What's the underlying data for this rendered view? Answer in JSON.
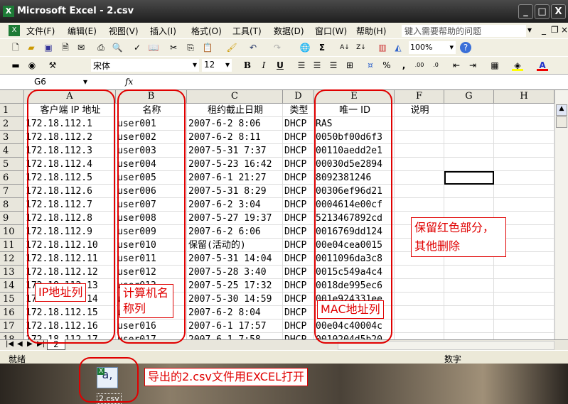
{
  "window": {
    "title": "Microsoft Excel - 2.csv",
    "min": "_",
    "max": "□",
    "close": "X"
  },
  "menu": [
    "文件(F)",
    "编辑(E)",
    "视图(V)",
    "插入(I)",
    "格式(O)",
    "工具(T)",
    "数据(D)",
    "窗口(W)",
    "帮助(H)"
  ],
  "help_placeholder": "键入需要帮助的问题",
  "toolbar": {
    "zoom": "100%",
    "font": "宋体",
    "size": "12",
    "bold": "B",
    "italic": "I",
    "underline": "U",
    "percent": "%",
    "comma": ",",
    "sigma": "Σ"
  },
  "formula": {
    "namebox": "G6",
    "fx": "fx",
    "value": ""
  },
  "columns": [
    "A",
    "B",
    "C",
    "D",
    "E",
    "F",
    "G",
    "H"
  ],
  "rows": [
    [
      "客户端 IP 地址",
      "名称",
      "租约截止日期",
      "类型",
      "唯一 ID",
      "说明"
    ],
    [
      "172.18.112.1",
      "user001",
      "2007-6-2 8:06",
      "DHCP",
      "RAS",
      ""
    ],
    [
      "172.18.112.2",
      "user002",
      "2007-6-2 8:11",
      "DHCP",
      "0050bf00d6f3",
      ""
    ],
    [
      "172.18.112.3",
      "user003",
      "2007-5-31 7:37",
      "DHCP",
      "00110aedd2e1",
      ""
    ],
    [
      "172.18.112.4",
      "user004",
      "2007-5-23 16:42",
      "DHCP",
      "00030d5e2894",
      ""
    ],
    [
      "172.18.112.5",
      "user005",
      "2007-6-1 21:27",
      "DHCP",
      "8092381246",
      ""
    ],
    [
      "172.18.112.6",
      "user006",
      "2007-5-31 8:29",
      "DHCP",
      "00306ef96d21",
      ""
    ],
    [
      "172.18.112.7",
      "user007",
      "2007-6-2 3:04",
      "DHCP",
      "0004614e00cf",
      ""
    ],
    [
      "172.18.112.8",
      "user008",
      "2007-5-27 19:37",
      "DHCP",
      "5213467892cd",
      ""
    ],
    [
      "172.18.112.9",
      "user009",
      "2007-6-2 6:06",
      "DHCP",
      "0016769dd124",
      ""
    ],
    [
      "172.18.112.10",
      "user010",
      "保留(活动的)",
      "DHCP",
      "00e04cea0015",
      ""
    ],
    [
      "172.18.112.11",
      "user011",
      "2007-5-31 14:04",
      "DHCP",
      "0011096da3c8",
      ""
    ],
    [
      "172.18.112.12",
      "user012",
      "2007-5-28 3:40",
      "DHCP",
      "0015c549a4c4",
      ""
    ],
    [
      "172.18.112.13",
      "user013",
      "2007-5-25 17:32",
      "DHCP",
      "0018de995ec6",
      ""
    ],
    [
      "172.18.112.14",
      "user014",
      "2007-5-30 14:59",
      "DHCP",
      "001e924331ee",
      ""
    ],
    [
      "172.18.112.15",
      "user015",
      "2007-6-2 8:04",
      "DHCP",
      "",
      ""
    ],
    [
      "172.18.112.16",
      "user016",
      "2007-6-1 17:57",
      "DHCP",
      "00e04c40004c",
      ""
    ],
    [
      "172.18.112.17",
      "user017",
      "2007-6-1 7:58",
      "DHCP",
      "0010204d5b20",
      ""
    ]
  ],
  "sheet_tab": "2",
  "status": {
    "left": "就绪",
    "num": "数字"
  },
  "annotations": {
    "ip": "IP地址列",
    "name": "计算机名称列",
    "mac": "MAC地址列",
    "keep": "保留红色部分，其他删除",
    "export": "导出的2.csv文件用EXCEL打开"
  },
  "desktop_icon": "2.csv"
}
